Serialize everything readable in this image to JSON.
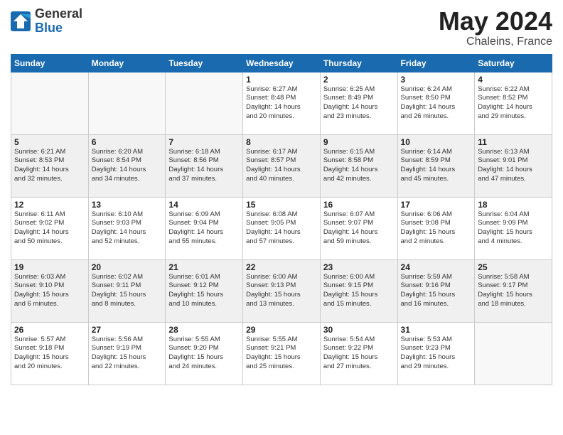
{
  "logo": {
    "general": "General",
    "blue": "Blue"
  },
  "title": {
    "month_year": "May 2024",
    "location": "Chaleins, France"
  },
  "headers": [
    "Sunday",
    "Monday",
    "Tuesday",
    "Wednesday",
    "Thursday",
    "Friday",
    "Saturday"
  ],
  "weeks": [
    [
      {
        "day": "",
        "info": "",
        "empty": true
      },
      {
        "day": "",
        "info": "",
        "empty": true
      },
      {
        "day": "",
        "info": "",
        "empty": true
      },
      {
        "day": "1",
        "info": "Sunrise: 6:27 AM\nSunset: 8:48 PM\nDaylight: 14 hours\nand 20 minutes."
      },
      {
        "day": "2",
        "info": "Sunrise: 6:25 AM\nSunset: 8:49 PM\nDaylight: 14 hours\nand 23 minutes."
      },
      {
        "day": "3",
        "info": "Sunrise: 6:24 AM\nSunset: 8:50 PM\nDaylight: 14 hours\nand 26 minutes."
      },
      {
        "day": "4",
        "info": "Sunrise: 6:22 AM\nSunset: 8:52 PM\nDaylight: 14 hours\nand 29 minutes."
      }
    ],
    [
      {
        "day": "5",
        "info": "Sunrise: 6:21 AM\nSunset: 8:53 PM\nDaylight: 14 hours\nand 32 minutes."
      },
      {
        "day": "6",
        "info": "Sunrise: 6:20 AM\nSunset: 8:54 PM\nDaylight: 14 hours\nand 34 minutes."
      },
      {
        "day": "7",
        "info": "Sunrise: 6:18 AM\nSunset: 8:56 PM\nDaylight: 14 hours\nand 37 minutes."
      },
      {
        "day": "8",
        "info": "Sunrise: 6:17 AM\nSunset: 8:57 PM\nDaylight: 14 hours\nand 40 minutes."
      },
      {
        "day": "9",
        "info": "Sunrise: 6:15 AM\nSunset: 8:58 PM\nDaylight: 14 hours\nand 42 minutes."
      },
      {
        "day": "10",
        "info": "Sunrise: 6:14 AM\nSunset: 8:59 PM\nDaylight: 14 hours\nand 45 minutes."
      },
      {
        "day": "11",
        "info": "Sunrise: 6:13 AM\nSunset: 9:01 PM\nDaylight: 14 hours\nand 47 minutes."
      }
    ],
    [
      {
        "day": "12",
        "info": "Sunrise: 6:11 AM\nSunset: 9:02 PM\nDaylight: 14 hours\nand 50 minutes."
      },
      {
        "day": "13",
        "info": "Sunrise: 6:10 AM\nSunset: 9:03 PM\nDaylight: 14 hours\nand 52 minutes."
      },
      {
        "day": "14",
        "info": "Sunrise: 6:09 AM\nSunset: 9:04 PM\nDaylight: 14 hours\nand 55 minutes."
      },
      {
        "day": "15",
        "info": "Sunrise: 6:08 AM\nSunset: 9:05 PM\nDaylight: 14 hours\nand 57 minutes."
      },
      {
        "day": "16",
        "info": "Sunrise: 6:07 AM\nSunset: 9:07 PM\nDaylight: 14 hours\nand 59 minutes."
      },
      {
        "day": "17",
        "info": "Sunrise: 6:06 AM\nSunset: 9:08 PM\nDaylight: 15 hours\nand 2 minutes."
      },
      {
        "day": "18",
        "info": "Sunrise: 6:04 AM\nSunset: 9:09 PM\nDaylight: 15 hours\nand 4 minutes."
      }
    ],
    [
      {
        "day": "19",
        "info": "Sunrise: 6:03 AM\nSunset: 9:10 PM\nDaylight: 15 hours\nand 6 minutes."
      },
      {
        "day": "20",
        "info": "Sunrise: 6:02 AM\nSunset: 9:11 PM\nDaylight: 15 hours\nand 8 minutes."
      },
      {
        "day": "21",
        "info": "Sunrise: 6:01 AM\nSunset: 9:12 PM\nDaylight: 15 hours\nand 10 minutes."
      },
      {
        "day": "22",
        "info": "Sunrise: 6:00 AM\nSunset: 9:13 PM\nDaylight: 15 hours\nand 13 minutes."
      },
      {
        "day": "23",
        "info": "Sunrise: 6:00 AM\nSunset: 9:15 PM\nDaylight: 15 hours\nand 15 minutes."
      },
      {
        "day": "24",
        "info": "Sunrise: 5:59 AM\nSunset: 9:16 PM\nDaylight: 15 hours\nand 16 minutes."
      },
      {
        "day": "25",
        "info": "Sunrise: 5:58 AM\nSunset: 9:17 PM\nDaylight: 15 hours\nand 18 minutes."
      }
    ],
    [
      {
        "day": "26",
        "info": "Sunrise: 5:57 AM\nSunset: 9:18 PM\nDaylight: 15 hours\nand 20 minutes."
      },
      {
        "day": "27",
        "info": "Sunrise: 5:56 AM\nSunset: 9:19 PM\nDaylight: 15 hours\nand 22 minutes."
      },
      {
        "day": "28",
        "info": "Sunrise: 5:55 AM\nSunset: 9:20 PM\nDaylight: 15 hours\nand 24 minutes."
      },
      {
        "day": "29",
        "info": "Sunrise: 5:55 AM\nSunset: 9:21 PM\nDaylight: 15 hours\nand 25 minutes."
      },
      {
        "day": "30",
        "info": "Sunrise: 5:54 AM\nSunset: 9:22 PM\nDaylight: 15 hours\nand 27 minutes."
      },
      {
        "day": "31",
        "info": "Sunrise: 5:53 AM\nSunset: 9:23 PM\nDaylight: 15 hours\nand 29 minutes."
      },
      {
        "day": "",
        "info": "",
        "empty": true
      }
    ]
  ]
}
